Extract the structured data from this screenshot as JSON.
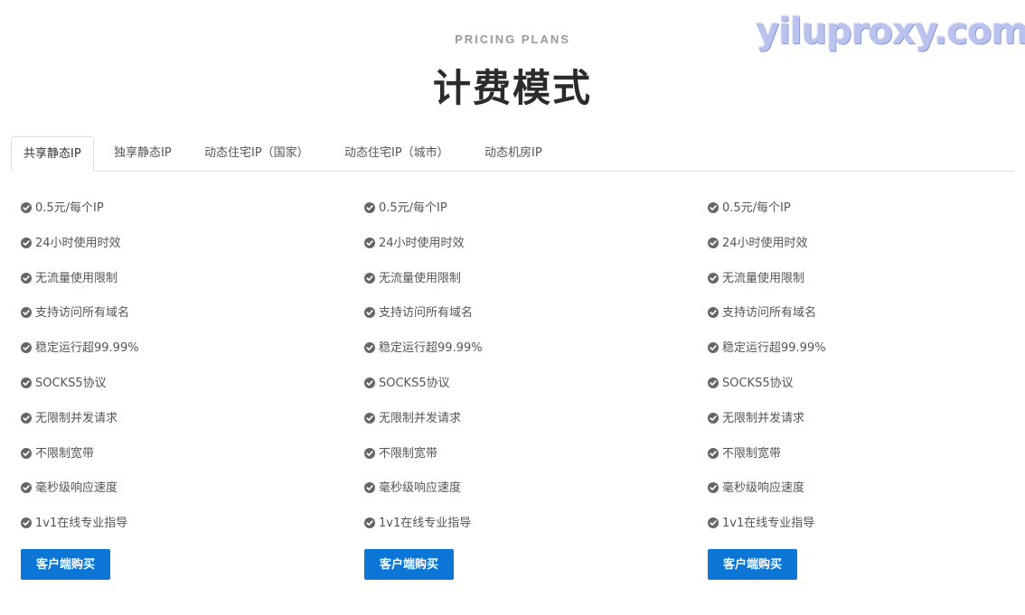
{
  "watermark": "yiluproxy.com",
  "header": {
    "eyebrow": "PRICING PLANS",
    "title": "计费模式"
  },
  "tabs": [
    {
      "label": "共享静态IP",
      "active": true
    },
    {
      "label": "独享静态IP",
      "active": false
    },
    {
      "label": "动态住宅IP（国家）",
      "active": false
    },
    {
      "label": "动态住宅IP（城市）",
      "active": false
    },
    {
      "label": "动态机房IP",
      "active": false
    }
  ],
  "icons": {
    "check": "check-circle-icon"
  },
  "colors": {
    "button": "#0b76d6",
    "check": "#666666"
  },
  "plans": [
    {
      "features": [
        "0.5元/每个IP",
        "24小时使用时效",
        "无流量使用限制",
        "支持访问所有域名",
        "稳定运行超99.99%",
        "SOCKS5协议",
        "无限制并发请求",
        "不限制宽带",
        "毫秒级响应速度",
        "1v1在线专业指导"
      ],
      "button": "客户端购买"
    },
    {
      "features": [
        "0.5元/每个IP",
        "24小时使用时效",
        "无流量使用限制",
        "支持访问所有域名",
        "稳定运行超99.99%",
        "SOCKS5协议",
        "无限制并发请求",
        "不限制宽带",
        "毫秒级响应速度",
        "1v1在线专业指导"
      ],
      "button": "客户端购买"
    },
    {
      "features": [
        "0.5元/每个IP",
        "24小时使用时效",
        "无流量使用限制",
        "支持访问所有域名",
        "稳定运行超99.99%",
        "SOCKS5协议",
        "无限制并发请求",
        "不限制宽带",
        "毫秒级响应速度",
        "1v1在线专业指导"
      ],
      "button": "客户端购买"
    }
  ]
}
